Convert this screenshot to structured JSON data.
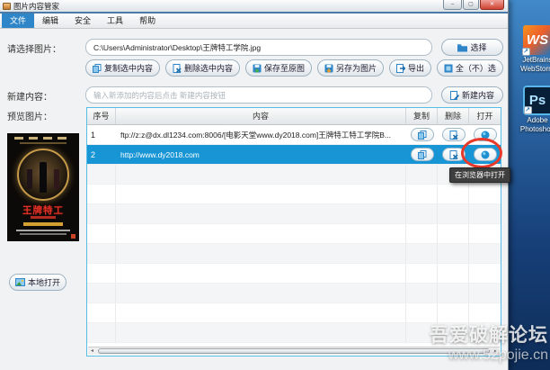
{
  "window": {
    "title": "图片内容管家"
  },
  "window_controls": {
    "minimize": "–",
    "maximize": "▢",
    "close": "✕"
  },
  "menu": {
    "items": [
      {
        "label": "文件"
      },
      {
        "label": "编辑"
      },
      {
        "label": "安全"
      },
      {
        "label": "工具"
      },
      {
        "label": "帮助"
      }
    ]
  },
  "select_image": {
    "label": "请选择图片：",
    "path": "C:\\Users\\Administrator\\Desktop\\王牌特工学院.jpg",
    "choose_button": "选择"
  },
  "toolbar": {
    "copy_selected": "复制选中内容",
    "delete_selected": "删除选中内容",
    "save_original": "保存至原图",
    "save_as_image": "另存为图片",
    "export": "导出",
    "select_all": "全（不）选"
  },
  "new_content": {
    "label": "新建内容：",
    "placeholder": "输入新添加的内容后点击 新建内容按钮",
    "button": "新建内容"
  },
  "preview": {
    "label": "预览图片：",
    "poster_title": "王牌特工"
  },
  "table": {
    "headers": {
      "no": "序号",
      "content": "内容",
      "copy": "复制",
      "delete": "删除",
      "open": "打开"
    },
    "rows": [
      {
        "no": "1",
        "content": "ftp://z:z@dx.dl1234.com:8006/[电影天堂www.dy2018.com]王牌特工特工学院B..."
      },
      {
        "no": "2",
        "content": "http://www.dy2018.com"
      }
    ]
  },
  "tooltip": {
    "text": "在浏览器中打开"
  },
  "local_open": {
    "button": "本地打开"
  },
  "desktop": {
    "icons": [
      {
        "logo_text": "WS",
        "label1": "JetBrains",
        "label2": "WebStorm"
      },
      {
        "logo_text": "Ps",
        "label1": "Adobe",
        "label2": "Photoshop"
      }
    ]
  },
  "watermark": {
    "line1": "吾爱破解论坛",
    "line2": "www.52pojie.cn"
  },
  "colors": {
    "accent_blue": "#2e86c8",
    "selected_row": "#1795d5",
    "table_border": "#56bee6",
    "annotation_red": "#e9392b"
  }
}
